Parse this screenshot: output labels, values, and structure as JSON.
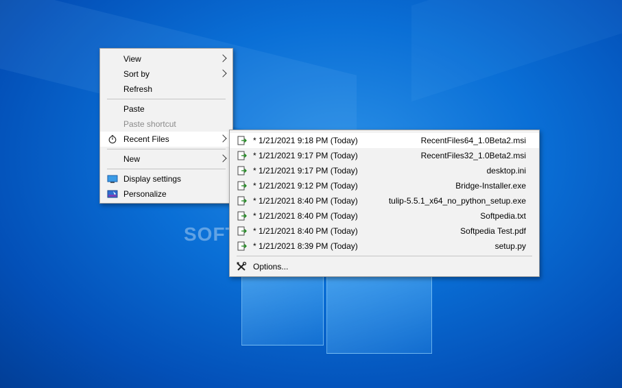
{
  "context_menu": {
    "items": [
      {
        "label": "View"
      },
      {
        "label": "Sort by"
      },
      {
        "label": "Refresh"
      },
      {
        "label": "Paste"
      },
      {
        "label": "Paste shortcut"
      },
      {
        "label": "Recent Files"
      },
      {
        "label": "New"
      },
      {
        "label": "Display settings"
      },
      {
        "label": "Personalize"
      }
    ]
  },
  "recent_files": {
    "entries": [
      {
        "date": "* 1/21/2021 9:18 PM (Today)",
        "name": "RecentFiles64_1.0Beta2.msi"
      },
      {
        "date": "* 1/21/2021 9:17 PM (Today)",
        "name": "RecentFiles32_1.0Beta2.msi"
      },
      {
        "date": "* 1/21/2021 9:17 PM (Today)",
        "name": "desktop.ini"
      },
      {
        "date": "* 1/21/2021 9:12 PM (Today)",
        "name": "Bridge-Installer.exe"
      },
      {
        "date": "* 1/21/2021 8:40 PM (Today)",
        "name": "tulip-5.5.1_x64_no_python_setup.exe"
      },
      {
        "date": "* 1/21/2021 8:40 PM (Today)",
        "name": "Softpedia.txt"
      },
      {
        "date": "* 1/21/2021 8:40 PM (Today)",
        "name": "Softpedia Test.pdf"
      },
      {
        "date": "* 1/21/2021 8:39 PM (Today)",
        "name": "setup.py"
      }
    ],
    "options_label": "Options..."
  },
  "icons": {
    "file": "file-arrow-icon",
    "recent": "stopwatch-icon",
    "display": "monitor-icon",
    "personalize": "personalize-icon",
    "options": "tools-icon"
  },
  "watermark": "SOFT",
  "colors": {
    "desktop": "#0a6fd6",
    "menu_bg": "#f2f2f2",
    "hover_bg": "#ffffff",
    "disabled_text": "#8a8a8a"
  }
}
